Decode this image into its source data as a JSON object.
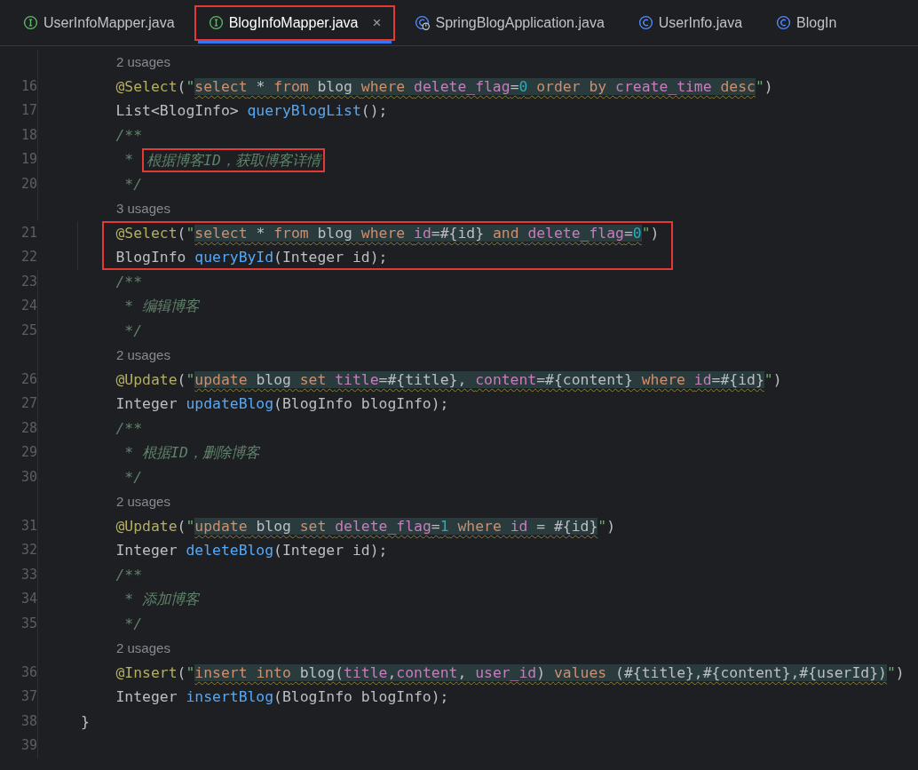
{
  "tabs": [
    {
      "label": "UserInfoMapper.java",
      "kind": "interface",
      "selected": false,
      "highlighted": false
    },
    {
      "label": "BlogInfoMapper.java",
      "kind": "interface",
      "selected": true,
      "highlighted": true,
      "close": "×"
    },
    {
      "label": "SpringBlogApplication.java",
      "kind": "app",
      "selected": false,
      "highlighted": false
    },
    {
      "label": "UserInfo.java",
      "kind": "class",
      "selected": false,
      "highlighted": false
    },
    {
      "label": "BlogIn",
      "kind": "class",
      "selected": false,
      "highlighted": false
    }
  ],
  "lines": [
    {
      "kind": "usages",
      "text": "2 usages"
    },
    {
      "kind": "code",
      "number": "16",
      "tokens": [
        {
          "kind": "annot",
          "text": "    @Select"
        },
        {
          "kind": "plain",
          "text": "("
        },
        {
          "kind": "quote",
          "text": "\""
        },
        {
          "kind": "kw",
          "text": "select"
        },
        {
          "kind": "sql",
          "text": " * "
        },
        {
          "kind": "kw",
          "text": "from"
        },
        {
          "kind": "sql",
          "text": " blog "
        },
        {
          "kind": "kw",
          "text": "where "
        },
        {
          "kind": "col",
          "text": "delete_flag"
        },
        {
          "kind": "sql",
          "text": "="
        },
        {
          "kind": "num",
          "text": "0"
        },
        {
          "kind": "kw",
          "text": " order by "
        },
        {
          "kind": "col",
          "text": "create_time"
        },
        {
          "kind": "kw",
          "text": " desc"
        },
        {
          "kind": "quote",
          "text": "\""
        },
        {
          "kind": "plain",
          "text": ")"
        }
      ]
    },
    {
      "kind": "code",
      "number": "17",
      "tokens": [
        {
          "kind": "plain",
          "text": "    List<BlogInfo> "
        },
        {
          "kind": "method",
          "text": "queryBlogList"
        },
        {
          "kind": "plain",
          "text": "();"
        }
      ]
    },
    {
      "kind": "code",
      "number": "18",
      "tokens": [
        {
          "kind": "comment",
          "text": "    /**"
        }
      ]
    },
    {
      "kind": "code",
      "number": "19",
      "tokens": [
        {
          "kind": "comment",
          "text": "     * "
        },
        {
          "kind": "comment",
          "text": "根据博客ID，获取博客详情",
          "boxed": true
        }
      ]
    },
    {
      "kind": "code",
      "number": "20",
      "tokens": [
        {
          "kind": "comment",
          "text": "     */"
        }
      ]
    },
    {
      "kind": "usages",
      "text": "3 usages"
    },
    {
      "kind": "code",
      "number": "21",
      "boxed": true,
      "tokens": [
        {
          "kind": "annot",
          "text": "    @Select"
        },
        {
          "kind": "plain",
          "text": "("
        },
        {
          "kind": "quote",
          "text": "\""
        },
        {
          "kind": "kw",
          "text": "select"
        },
        {
          "kind": "sql",
          "text": " * "
        },
        {
          "kind": "kw",
          "text": "from"
        },
        {
          "kind": "sql",
          "text": " blog "
        },
        {
          "kind": "kw",
          "text": "where "
        },
        {
          "kind": "col",
          "text": "id"
        },
        {
          "kind": "sql",
          "text": "=#{id} "
        },
        {
          "kind": "kw",
          "text": "and "
        },
        {
          "kind": "col",
          "text": "delete_flag"
        },
        {
          "kind": "sql",
          "text": "="
        },
        {
          "kind": "num",
          "text": "0"
        },
        {
          "kind": "quote",
          "text": "\""
        },
        {
          "kind": "plain",
          "text": ")"
        }
      ]
    },
    {
      "kind": "code",
      "number": "22",
      "boxed": true,
      "tokens": [
        {
          "kind": "plain",
          "text": "    BlogInfo "
        },
        {
          "kind": "method",
          "text": "queryById"
        },
        {
          "kind": "plain",
          "text": "(Integer id);"
        }
      ]
    },
    {
      "kind": "code",
      "number": "23",
      "tokens": [
        {
          "kind": "comment",
          "text": "    /**"
        }
      ]
    },
    {
      "kind": "code",
      "number": "24",
      "tokens": [
        {
          "kind": "comment",
          "text": "     * 编辑博客"
        }
      ]
    },
    {
      "kind": "code",
      "number": "25",
      "tokens": [
        {
          "kind": "comment",
          "text": "     */"
        }
      ]
    },
    {
      "kind": "usages",
      "text": "2 usages"
    },
    {
      "kind": "code",
      "number": "26",
      "tokens": [
        {
          "kind": "annot",
          "text": "    @Update"
        },
        {
          "kind": "plain",
          "text": "("
        },
        {
          "kind": "quote",
          "text": "\""
        },
        {
          "kind": "kw",
          "text": "update"
        },
        {
          "kind": "sql",
          "text": " blog "
        },
        {
          "kind": "kw",
          "text": "set "
        },
        {
          "kind": "col",
          "text": "title"
        },
        {
          "kind": "sql",
          "text": "=#{title}, "
        },
        {
          "kind": "col",
          "text": "content"
        },
        {
          "kind": "sql",
          "text": "=#{content} "
        },
        {
          "kind": "kw",
          "text": "where "
        },
        {
          "kind": "col",
          "text": "id"
        },
        {
          "kind": "sql",
          "text": "=#{id}"
        },
        {
          "kind": "quote",
          "text": "\""
        },
        {
          "kind": "plain",
          "text": ")"
        }
      ]
    },
    {
      "kind": "code",
      "number": "27",
      "tokens": [
        {
          "kind": "plain",
          "text": "    Integer "
        },
        {
          "kind": "method",
          "text": "updateBlog"
        },
        {
          "kind": "plain",
          "text": "(BlogInfo blogInfo);"
        }
      ]
    },
    {
      "kind": "code",
      "number": "28",
      "tokens": [
        {
          "kind": "comment",
          "text": "    /**"
        }
      ]
    },
    {
      "kind": "code",
      "number": "29",
      "tokens": [
        {
          "kind": "comment",
          "text": "     * 根据ID，删除博客"
        }
      ]
    },
    {
      "kind": "code",
      "number": "30",
      "tokens": [
        {
          "kind": "comment",
          "text": "     */"
        }
      ]
    },
    {
      "kind": "usages",
      "text": "2 usages"
    },
    {
      "kind": "code",
      "number": "31",
      "tokens": [
        {
          "kind": "annot",
          "text": "    @Update"
        },
        {
          "kind": "plain",
          "text": "("
        },
        {
          "kind": "quote",
          "text": "\""
        },
        {
          "kind": "kw",
          "text": "update"
        },
        {
          "kind": "sql",
          "text": " blog "
        },
        {
          "kind": "kw",
          "text": "set "
        },
        {
          "kind": "col",
          "text": "delete_flag"
        },
        {
          "kind": "sql",
          "text": "="
        },
        {
          "kind": "num",
          "text": "1"
        },
        {
          "kind": "kw",
          "text": " where "
        },
        {
          "kind": "col",
          "text": "id"
        },
        {
          "kind": "sql",
          "text": " = #{id}"
        },
        {
          "kind": "quote",
          "text": "\""
        },
        {
          "kind": "plain",
          "text": ")"
        }
      ]
    },
    {
      "kind": "code",
      "number": "32",
      "tokens": [
        {
          "kind": "plain",
          "text": "    Integer "
        },
        {
          "kind": "method",
          "text": "deleteBlog"
        },
        {
          "kind": "plain",
          "text": "(Integer id);"
        }
      ]
    },
    {
      "kind": "code",
      "number": "33",
      "tokens": [
        {
          "kind": "comment",
          "text": "    /**"
        }
      ]
    },
    {
      "kind": "code",
      "number": "34",
      "tokens": [
        {
          "kind": "comment",
          "text": "     * 添加博客"
        }
      ]
    },
    {
      "kind": "code",
      "number": "35",
      "tokens": [
        {
          "kind": "comment",
          "text": "     */"
        }
      ]
    },
    {
      "kind": "usages",
      "text": "2 usages"
    },
    {
      "kind": "code",
      "number": "36",
      "tokens": [
        {
          "kind": "annot",
          "text": "    @Insert"
        },
        {
          "kind": "plain",
          "text": "("
        },
        {
          "kind": "quote",
          "text": "\""
        },
        {
          "kind": "kw",
          "text": "insert into"
        },
        {
          "kind": "sql",
          "text": " blog("
        },
        {
          "kind": "col",
          "text": "title"
        },
        {
          "kind": "sql",
          "text": ","
        },
        {
          "kind": "col",
          "text": "content"
        },
        {
          "kind": "sql",
          "text": ", "
        },
        {
          "kind": "col",
          "text": "user_id"
        },
        {
          "kind": "sql",
          "text": ") "
        },
        {
          "kind": "kw",
          "text": "values"
        },
        {
          "kind": "sql",
          "text": " (#{title},#{content},#{userId})"
        },
        {
          "kind": "quote",
          "text": "\""
        },
        {
          "kind": "plain",
          "text": ")"
        }
      ]
    },
    {
      "kind": "code",
      "number": "37",
      "tokens": [
        {
          "kind": "plain",
          "text": "    Integer "
        },
        {
          "kind": "method",
          "text": "insertBlog"
        },
        {
          "kind": "plain",
          "text": "(BlogInfo blogInfo);"
        }
      ]
    },
    {
      "kind": "code",
      "number": "38",
      "tokens": [
        {
          "kind": "plain",
          "text": "}"
        }
      ]
    },
    {
      "kind": "code",
      "number": "39"
    }
  ]
}
